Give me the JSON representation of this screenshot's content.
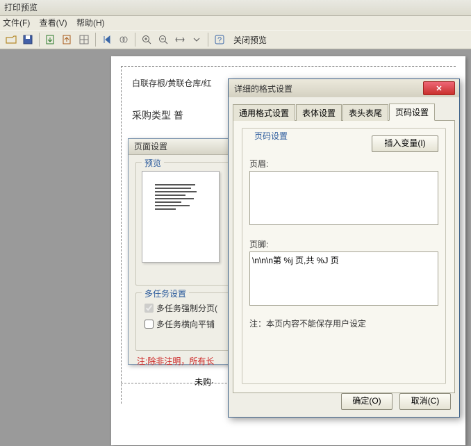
{
  "window": {
    "title": "打印预览"
  },
  "menubar": {
    "file": "文件(F)",
    "view": "查看(V)",
    "help": "帮助(H)"
  },
  "toolbar": {
    "close_preview": "关闭预览"
  },
  "page": {
    "line1": "白联存根/黄联仓库/红",
    "line2": "采购类型  普",
    "footer_label": "未购·"
  },
  "page_dialog": {
    "title": "页面设置",
    "preview_group": "预览",
    "multitask_group": "多任务设置",
    "force_paging": "多任务强制分页(",
    "tile_horizontal": "多任务横向平铺",
    "note": "注:除非注明，所有长"
  },
  "format_dialog": {
    "title": "详细的格式设置",
    "tabs": {
      "general": "通用格式设置",
      "font": "表体设置",
      "header_footer": "表头表尾",
      "page_number": "页码设置"
    },
    "fieldset_label": "页码设置",
    "insert_var": "插入变量(I)",
    "header_label": "页眉:",
    "header_value": "",
    "footer_label": "页脚:",
    "footer_value": "\\n\\n\\n第 %j 页,共 %J 页",
    "hint": "注：本页内容不能保存用户设定",
    "ok": "确定(O)",
    "cancel": "取消(C)"
  }
}
